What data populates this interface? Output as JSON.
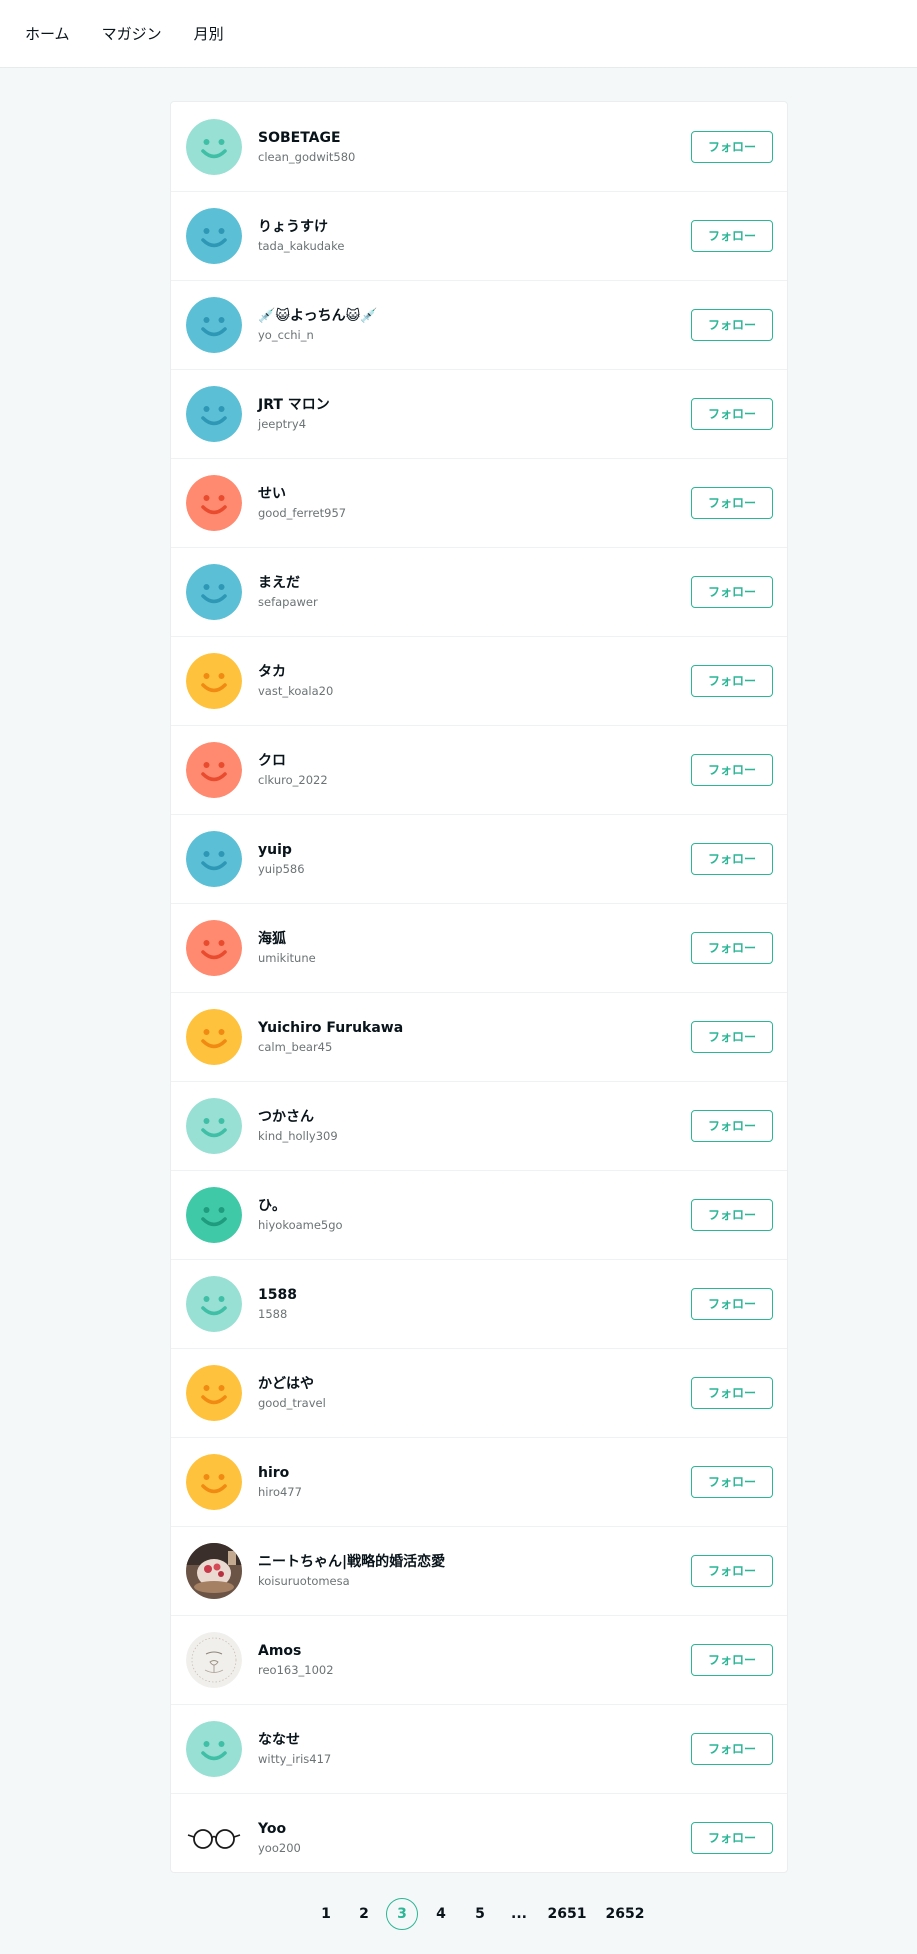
{
  "nav": {
    "items": [
      {
        "label": "ホーム"
      },
      {
        "label": "マガジン"
      },
      {
        "label": "月別"
      }
    ]
  },
  "users": [
    {
      "name": "SOBETAGE",
      "handle": "clean_godwit580",
      "avatar": "smiley",
      "avatar_color": "#99e0d4",
      "face_color": "#3fbfa6",
      "follow_label": "フォロー"
    },
    {
      "name": "りょうすけ",
      "handle": "tada_kakudake",
      "avatar": "smiley",
      "avatar_color": "#5bbfd6",
      "face_color": "#2e97b5",
      "follow_label": "フォロー"
    },
    {
      "name": "💉😺よっちん😺💉",
      "handle": "yo_cchi_n",
      "avatar": "smiley",
      "avatar_color": "#5bbfd6",
      "face_color": "#2e97b5",
      "follow_label": "フォロー"
    },
    {
      "name": "JRT マロン",
      "handle": "jeeptry4",
      "avatar": "smiley",
      "avatar_color": "#5bbfd6",
      "face_color": "#2e97b5",
      "follow_label": "フォロー"
    },
    {
      "name": "せい",
      "handle": "good_ferret957",
      "avatar": "smiley",
      "avatar_color": "#ff8a70",
      "face_color": "#e94b2e",
      "follow_label": "フォロー"
    },
    {
      "name": "まえだ",
      "handle": "sefapawer",
      "avatar": "smiley",
      "avatar_color": "#5bbfd6",
      "face_color": "#2e97b5",
      "follow_label": "フォロー"
    },
    {
      "name": "タカ",
      "handle": "vast_koala20",
      "avatar": "smiley",
      "avatar_color": "#ffc23d",
      "face_color": "#f08a12",
      "follow_label": "フォロー"
    },
    {
      "name": "クロ",
      "handle": "clkuro_2022",
      "avatar": "smiley",
      "avatar_color": "#ff8a70",
      "face_color": "#e94b2e",
      "follow_label": "フォロー"
    },
    {
      "name": "yuip",
      "handle": "yuip586",
      "avatar": "smiley",
      "avatar_color": "#5bbfd6",
      "face_color": "#2e97b5",
      "follow_label": "フォロー"
    },
    {
      "name": "海狐",
      "handle": "umikitune",
      "avatar": "smiley",
      "avatar_color": "#ff8a70",
      "face_color": "#e94b2e",
      "follow_label": "フォロー"
    },
    {
      "name": "Yuichiro Furukawa",
      "handle": "calm_bear45",
      "avatar": "smiley",
      "avatar_color": "#ffc23d",
      "face_color": "#f08a12",
      "follow_label": "フォロー"
    },
    {
      "name": "つかさん",
      "handle": "kind_holly309",
      "avatar": "smiley",
      "avatar_color": "#99e0d4",
      "face_color": "#3fbfa6",
      "follow_label": "フォロー"
    },
    {
      "name": "ひ。",
      "handle": "hiyokoame5go",
      "avatar": "smiley",
      "avatar_color": "#40c9a7",
      "face_color": "#1f9b7d",
      "follow_label": "フォロー"
    },
    {
      "name": "1588",
      "handle": "1588",
      "avatar": "smiley",
      "avatar_color": "#99e0d4",
      "face_color": "#3fbfa6",
      "follow_label": "フォロー"
    },
    {
      "name": "かどはや",
      "handle": "good_travel",
      "avatar": "smiley",
      "avatar_color": "#ffc23d",
      "face_color": "#f08a12",
      "follow_label": "フォロー"
    },
    {
      "name": "hiro",
      "handle": "hiro477",
      "avatar": "smiley",
      "avatar_color": "#ffc23d",
      "face_color": "#f08a12",
      "follow_label": "フォロー"
    },
    {
      "name": "ニートちゃん|戦略的婚活恋愛",
      "handle": "koisuruotomesa",
      "avatar": "photo",
      "follow_label": "フォロー"
    },
    {
      "name": "Amos",
      "handle": "reo163_1002",
      "avatar": "stamp",
      "follow_label": "フォロー"
    },
    {
      "name": "ななせ",
      "handle": "witty_iris417",
      "avatar": "smiley",
      "avatar_color": "#99e0d4",
      "face_color": "#3fbfa6",
      "follow_label": "フォロー"
    },
    {
      "name": "Yoo",
      "handle": "yoo200",
      "avatar": "glasses",
      "follow_label": "フォロー"
    }
  ],
  "pagination": {
    "pages": [
      "1",
      "2",
      "3",
      "4",
      "5",
      "...",
      "2651",
      "2652"
    ],
    "current": "3",
    "accent_color": "#2cb696"
  }
}
